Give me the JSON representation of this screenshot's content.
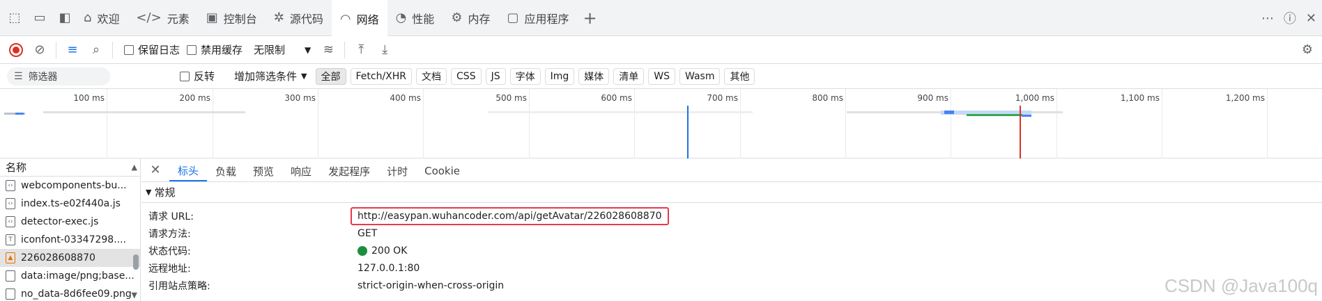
{
  "tabs": [
    {
      "label": "欢迎",
      "icon": "home-icon"
    },
    {
      "label": "元素",
      "icon": "code-icon"
    },
    {
      "label": "控制台",
      "icon": "console-icon"
    },
    {
      "label": "源代码",
      "icon": "bug-icon"
    },
    {
      "label": "网络",
      "icon": "wifi-icon"
    },
    {
      "label": "性能",
      "icon": "gauge-icon"
    },
    {
      "label": "内存",
      "icon": "memory-icon"
    },
    {
      "label": "应用程序",
      "icon": "app-icon"
    }
  ],
  "toolbar": {
    "preserve_log": "保留日志",
    "disable_cache": "禁用缓存",
    "throttle": "无限制"
  },
  "filter": {
    "placeholder": "筛选器",
    "invert": "反转",
    "more_filters": "增加筛选条件",
    "chips": [
      "全部",
      "Fetch/XHR",
      "文档",
      "CSS",
      "JS",
      "字体",
      "Img",
      "媒体",
      "清单",
      "WS",
      "Wasm",
      "其他"
    ]
  },
  "timeline": {
    "ticks": [
      "100 ms",
      "200 ms",
      "300 ms",
      "400 ms",
      "500 ms",
      "600 ms",
      "700 ms",
      "800 ms",
      "900 ms",
      "1,000 ms",
      "1,100 ms",
      "1,200 ms"
    ]
  },
  "requests": {
    "header": "名称",
    "items": [
      {
        "name": "webcomponents-bu...",
        "type": "script"
      },
      {
        "name": "index.ts-e02f440a.js",
        "type": "script"
      },
      {
        "name": "detector-exec.js",
        "type": "script"
      },
      {
        "name": "iconfont-03347298....",
        "type": "font"
      },
      {
        "name": "226028608870",
        "type": "image"
      },
      {
        "name": "data:image/png;base...",
        "type": "image"
      },
      {
        "name": "no_data-8d6fee09.png",
        "type": "image"
      }
    ]
  },
  "detail": {
    "tabs": [
      "标头",
      "负载",
      "预览",
      "响应",
      "发起程序",
      "计时",
      "Cookie"
    ],
    "section": "常规",
    "fields": [
      {
        "key": "请求 URL:",
        "value": "http://easypan.wuhancoder.com/api/getAvatar/226028608870"
      },
      {
        "key": "请求方法:",
        "value": "GET"
      },
      {
        "key": "状态代码:",
        "value": "200 OK"
      },
      {
        "key": "远程地址:",
        "value": "127.0.0.1:80"
      },
      {
        "key": "引用站点策略:",
        "value": "strict-origin-when-cross-origin"
      }
    ]
  },
  "watermark": "CSDN @Java100q",
  "colors": {
    "accent": "#1a73e8",
    "record": "#d93025",
    "status_ok": "#1e8e3e",
    "highlight": "#e8384f"
  }
}
